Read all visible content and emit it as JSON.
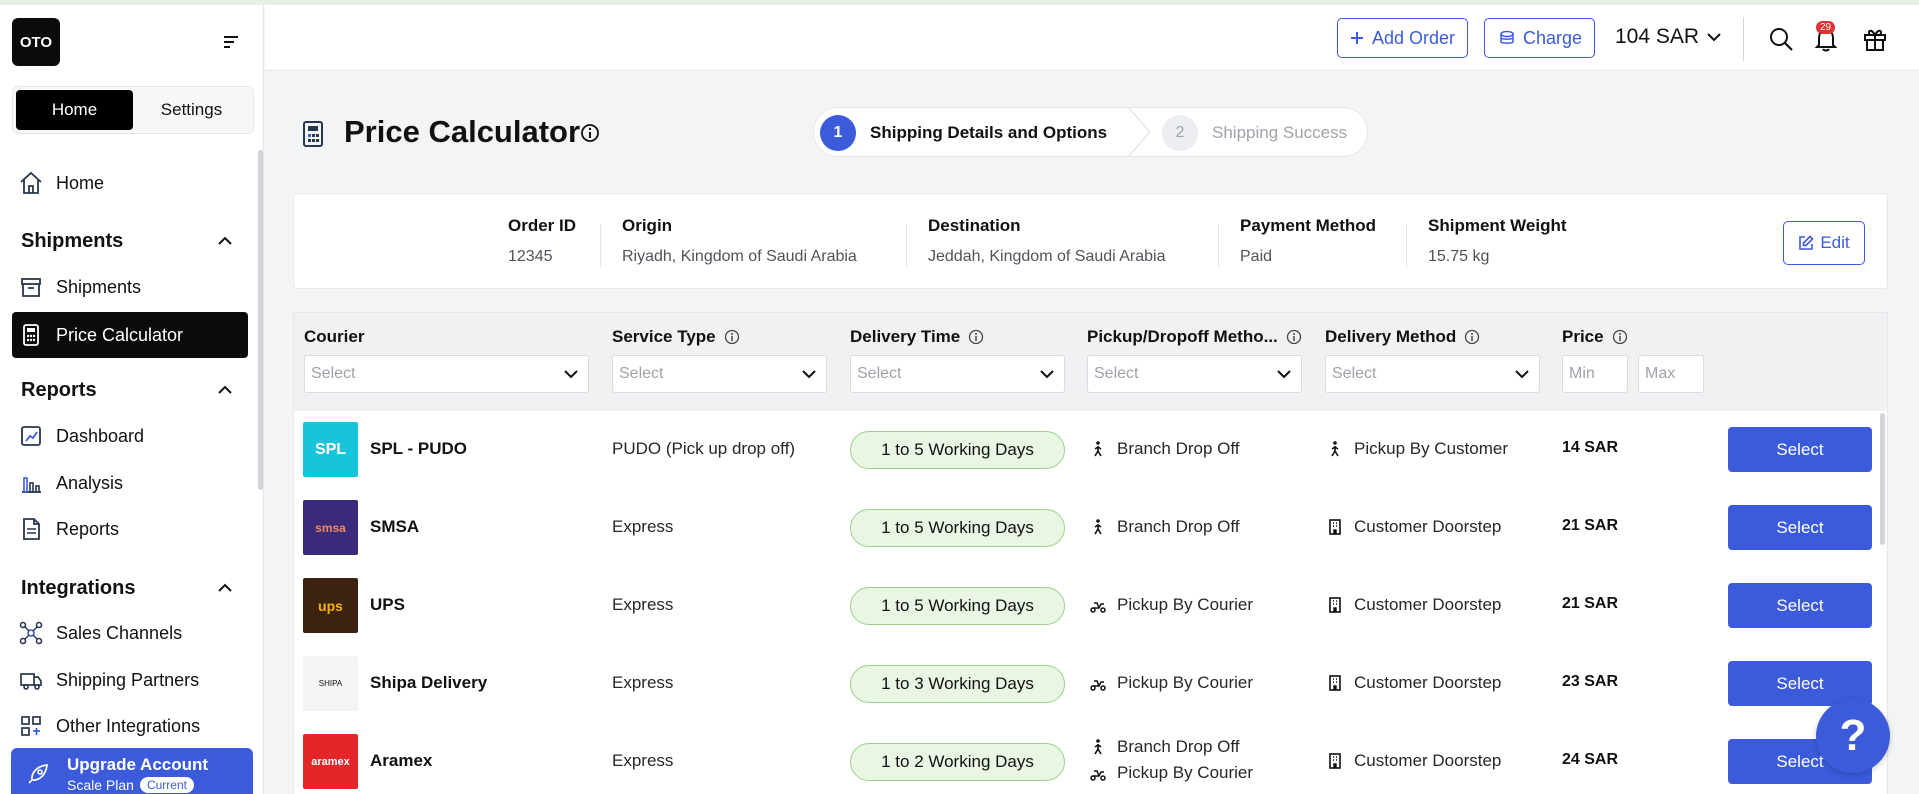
{
  "app": {
    "logo_text": "OTO"
  },
  "sidebar": {
    "tabs": [
      {
        "label": "Home"
      },
      {
        "label": "Settings"
      }
    ],
    "home_label": "Home",
    "sections": [
      {
        "title": "Shipments",
        "items": [
          {
            "label": "Shipments"
          },
          {
            "label": "Price Calculator"
          }
        ]
      },
      {
        "title": "Reports",
        "items": [
          {
            "label": "Dashboard"
          },
          {
            "label": "Analysis"
          },
          {
            "label": "Reports"
          }
        ]
      },
      {
        "title": "Integrations",
        "items": [
          {
            "label": "Sales Channels"
          },
          {
            "label": "Shipping Partners"
          },
          {
            "label": "Other Integrations"
          }
        ]
      }
    ],
    "upgrade": {
      "title": "Upgrade Account",
      "plan": "Scale Plan",
      "current": "Current"
    }
  },
  "header": {
    "add_order": "Add Order",
    "charge": "Charge",
    "balance": "104 SAR",
    "notifications_count": "29"
  },
  "page": {
    "title": "Price Calculator"
  },
  "stepper": {
    "steps": [
      {
        "number": "1",
        "label": "Shipping Details and Options"
      },
      {
        "number": "2",
        "label": "Shipping Success"
      }
    ]
  },
  "order": {
    "order_id_label": "Order ID",
    "order_id": "12345",
    "origin_label": "Origin",
    "origin": "Riyadh, Kingdom of Saudi Arabia",
    "destination_label": "Destination",
    "destination": "Jeddah, Kingdom of Saudi Arabia",
    "payment_label": "Payment Method",
    "payment": "Paid",
    "weight_label": "Shipment Weight",
    "weight": "15.75 kg",
    "edit_label": "Edit"
  },
  "table": {
    "headers": {
      "courier": "Courier",
      "service_type": "Service Type",
      "delivery_time": "Delivery Time",
      "pickup": "Pickup/Dropoff Metho...",
      "delivery_method": "Delivery Method",
      "price": "Price"
    },
    "filter_placeholder": "Select",
    "min_placeholder": "Min",
    "max_placeholder": "Max",
    "select_label": "Select",
    "rows": [
      {
        "courier": "SPL - PUDO",
        "logo_text": "SPL",
        "service": "PUDO (Pick up drop off)",
        "time": "1 to 5 Working Days",
        "pickup": [
          "Branch Drop Off"
        ],
        "delivery": "Pickup By Customer",
        "price": "14 SAR"
      },
      {
        "courier": "SMSA",
        "logo_text": "smsa",
        "service": "Express",
        "time": "1 to 5 Working Days",
        "pickup": [
          "Branch Drop Off"
        ],
        "delivery": "Customer Doorstep",
        "price": "21 SAR"
      },
      {
        "courier": "UPS",
        "logo_text": "ups",
        "service": "Express",
        "time": "1 to 5 Working Days",
        "pickup": [
          "Pickup By Courier"
        ],
        "delivery": "Customer Doorstep",
        "price": "21 SAR"
      },
      {
        "courier": "Shipa Delivery",
        "logo_text": "SHIPA",
        "service": "Express",
        "time": "1 to 3 Working Days",
        "pickup": [
          "Pickup By Courier"
        ],
        "delivery": "Customer Doorstep",
        "price": "23 SAR"
      },
      {
        "courier": "Aramex",
        "logo_text": "aramex",
        "service": "Express",
        "time": "1 to 2 Working Days",
        "pickup": [
          "Branch Drop Off",
          "Pickup By Courier"
        ],
        "delivery": "Customer Doorstep",
        "price": "24 SAR"
      }
    ]
  },
  "help": {
    "label": "?"
  },
  "colors": {
    "accent": "#3b5bdb",
    "sidebar_active": "#0b0b0b",
    "badge": "#e03131",
    "time_pill": "#e8f6e3"
  }
}
